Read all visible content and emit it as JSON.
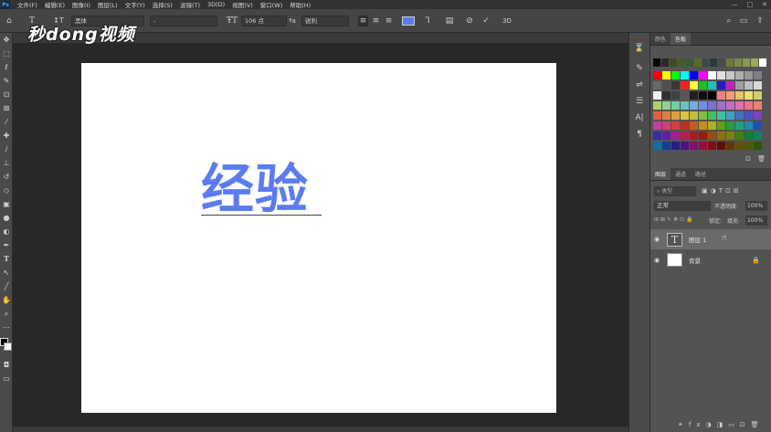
{
  "app": {
    "logo": "Ps"
  },
  "menubar": {
    "items": [
      "文件(F)",
      "编辑(E)",
      "图像(I)",
      "图层(L)",
      "文字(Y)",
      "选择(S)",
      "滤镜(T)",
      "3D(D)",
      "视图(V)",
      "窗口(W)",
      "帮助(H)"
    ]
  },
  "window_controls": [
    "—",
    "□",
    "✕"
  ],
  "options_bar": {
    "font_family": "黑体",
    "font_style": "-",
    "font_size": "106 点",
    "antialias": "锐利",
    "text_color": "#5b7cef"
  },
  "watermark": {
    "text": "秒dong视频"
  },
  "canvas": {
    "text": "经验",
    "text_color": "#5b7cef"
  },
  "right_panel": {
    "top_tabs": [
      "颜色",
      "色板"
    ],
    "layers_tabs": [
      "图层",
      "通道",
      "路径"
    ],
    "filter_placeholder": "类型",
    "blend_mode": "正常",
    "opacity_label": "不透明度:",
    "opacity_value": "100%",
    "lock_label": "锁定:",
    "fill_label": "填充:",
    "fill_value": "100%",
    "layers": [
      {
        "name": "图层 1",
        "type": "text",
        "selected": true
      },
      {
        "name": "背景",
        "type": "background",
        "selected": false
      }
    ]
  },
  "swatches": {
    "rows": [
      [
        "#000000",
        "#2a2a2a",
        "#404a2a",
        "#4a5a2a",
        "#3a5a3a",
        "#5a6a2a",
        "#3a4a4a",
        "#2a3a3a",
        "#4a4a4a",
        "#6a7a3a",
        "#7a8a4a",
        "#8a9a4a",
        "#9aaa5a",
        "#ffffff"
      ],
      [],
      [
        "#ff0000",
        "#ffff00",
        "#00ff00",
        "#00ffff",
        "#0000ff",
        "#ff00ff",
        "#ffffff",
        "#e0e0e0",
        "#c8c8c8",
        "#b0b0b0",
        "#989898",
        "#808080"
      ],
      [
        "#686868",
        "#505050",
        "#383838",
        "#ff2020",
        "#ffff40",
        "#20c020",
        "#20c0c0",
        "#2020c0",
        "#c020c0",
        "#a0a0a0",
        "#c0c0c0",
        "#d8d8d8"
      ],
      [
        "#f0f0f0",
        "#303030",
        "#404040",
        "#585858",
        "#202020",
        "#101010",
        "#000000",
        "#f08080",
        "#f0a070",
        "#f0c070",
        "#f0e070",
        "#d0d070"
      ],
      [
        "#b0d070",
        "#90d090",
        "#70d0a0",
        "#70c0c0",
        "#70b0e0",
        "#7090e0",
        "#8070d0",
        "#a070d0",
        "#c070c0",
        "#e070b0",
        "#f07090",
        "#f08070"
      ],
      [
        "#e06040",
        "#e08040",
        "#e0a040",
        "#e0c040",
        "#c0c040",
        "#80c040",
        "#40c060",
        "#40c0a0",
        "#40a0c0",
        "#4070c0",
        "#5050c0",
        "#8040c0"
      ],
      [
        "#c040a0",
        "#d04070",
        "#d04040",
        "#c03020",
        "#c06020",
        "#c09020",
        "#b0b020",
        "#60a020",
        "#20a040",
        "#20a080",
        "#208ab0",
        "#2050b0"
      ],
      [
        "#3030a0",
        "#6020a0",
        "#a02090",
        "#b02050",
        "#a02020",
        "#902010",
        "#905010",
        "#907010",
        "#808010",
        "#408010",
        "#108030",
        "#108060"
      ],
      [
        "#1070a0",
        "#104090",
        "#202080",
        "#501080",
        "#801070",
        "#901040",
        "#801010",
        "#601008",
        "#603808",
        "#605008",
        "#505808",
        "#285808"
      ]
    ]
  }
}
